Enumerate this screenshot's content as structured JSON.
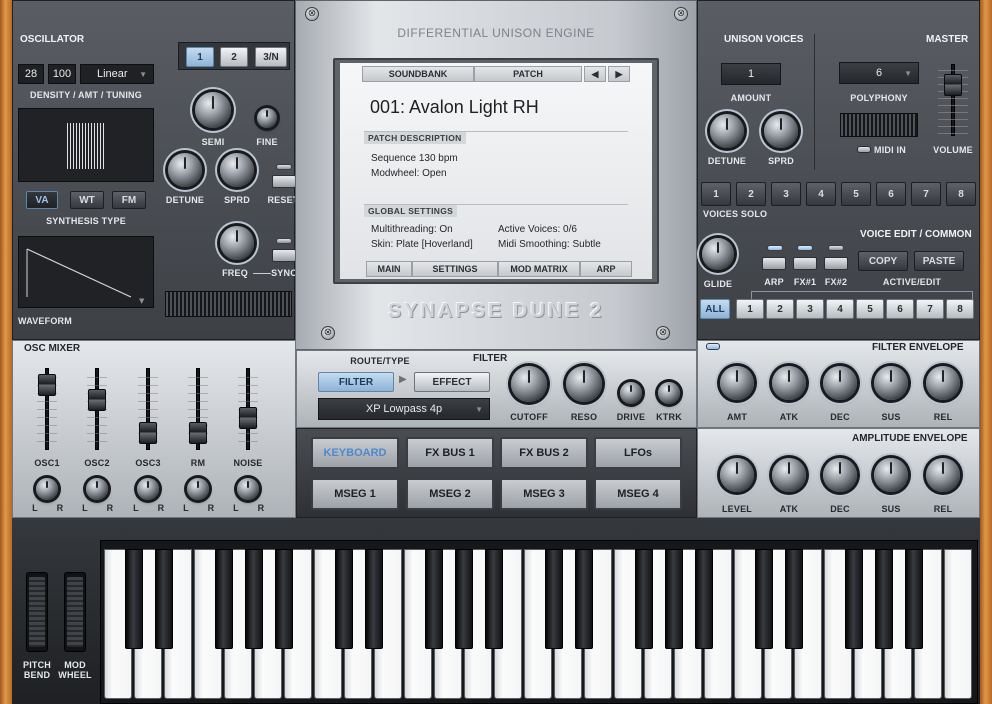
{
  "oscillator": {
    "title": "OSCILLATOR",
    "density": "28",
    "amount": "100",
    "tuning": "Linear",
    "tuning_label": "DENSITY / AMT / TUNING",
    "osc_tabs": [
      "1",
      "2",
      "3/N"
    ],
    "semi": "SEMI",
    "fine": "FINE",
    "detune": "DETUNE",
    "sprd": "SPRD",
    "reset": "RESET",
    "freq": "FREQ",
    "sync": "SYNC",
    "synthesis_types": [
      "VA",
      "WT",
      "FM"
    ],
    "synthesis_label": "SYNTHESIS TYPE",
    "waveform": "WAVEFORM"
  },
  "display": {
    "engine": "DIFFERENTIAL UNISON ENGINE",
    "tabs_top": [
      "SOUNDBANK",
      "PATCH"
    ],
    "prev": "◀",
    "next": "▶",
    "patch_name": "001: Avalon Light RH",
    "patch_desc_head": "PATCH DESCRIPTION",
    "desc_lines": [
      "Sequence 130 bpm",
      "Modwheel: Open"
    ],
    "global_head": "GLOBAL SETTINGS",
    "global": {
      "multithreading": "Multithreading: On",
      "skin": "Skin: Plate [Hoverland]",
      "active_voices": "Active Voices: 0/6",
      "midi_smoothing": "Midi Smoothing: Subtle"
    },
    "tabs_bottom": [
      "MAIN",
      "SETTINGS",
      "MOD MATRIX",
      "ARP"
    ],
    "brand": "SYNAPSE DUNE 2"
  },
  "unison": {
    "title": "UNISON VOICES",
    "amount_value": "1",
    "amount": "AMOUNT",
    "detune": "DETUNE",
    "sprd": "SPRD"
  },
  "master": {
    "title": "MASTER",
    "polyphony_value": "6",
    "polyphony": "POLYPHONY",
    "midi_in": "MIDI IN",
    "volume": "VOLUME"
  },
  "voices_solo": {
    "label": "VOICES SOLO",
    "buttons": [
      "1",
      "2",
      "3",
      "4",
      "5",
      "6",
      "7",
      "8"
    ]
  },
  "voice_edit": {
    "title": "VOICE EDIT / COMMON",
    "glide": "GLIDE",
    "arp": "ARP",
    "fx1": "FX#1",
    "fx2": "FX#2",
    "copy": "COPY",
    "paste": "PASTE",
    "active_edit": "ACTIVE/EDIT",
    "buttons": [
      "ALL",
      "1",
      "2",
      "3",
      "4",
      "5",
      "6",
      "7",
      "8"
    ]
  },
  "osc_mixer": {
    "title": "OSC MIXER",
    "channels": [
      "OSC1",
      "OSC2",
      "OSC3",
      "RM",
      "NOISE"
    ],
    "levels": [
      0.9,
      0.65,
      0.1,
      0.1,
      0.35
    ],
    "pan_left": "L",
    "pan_right": "R"
  },
  "filter": {
    "route_type": "ROUTE/TYPE",
    "title": "FILTER",
    "route_filter": "FILTER",
    "route_effect": "EFFECT",
    "type": "XP Lowpass 4p",
    "cutoff": "CUTOFF",
    "reso": "RESO",
    "drive": "DRIVE",
    "ktrk": "KTRK"
  },
  "mod_buttons": [
    "KEYBOARD",
    "FX BUS 1",
    "FX BUS 2",
    "LFOs",
    "MSEG 1",
    "MSEG 2",
    "MSEG 3",
    "MSEG 4"
  ],
  "filter_env": {
    "title": "FILTER  ENVELOPE",
    "knobs": [
      "AMT",
      "ATK",
      "DEC",
      "SUS",
      "REL"
    ]
  },
  "amp_env": {
    "title": "AMPLITUDE ENVELOPE",
    "knobs": [
      "LEVEL",
      "ATK",
      "DEC",
      "SUS",
      "REL"
    ]
  },
  "wheels": {
    "pitch": [
      "PITCH",
      "BEND"
    ],
    "mod": [
      "MOD",
      "WHEEL"
    ]
  },
  "colors": {
    "accent": "#8fb3d6",
    "wood": "#d0883c",
    "panel": "#4a4d52"
  }
}
